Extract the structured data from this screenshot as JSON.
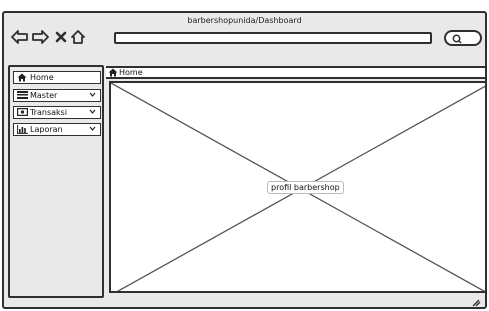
{
  "window": {
    "title": "barbershopunida/Dashboard"
  },
  "toolbar": {
    "icons": [
      "back-arrow-icon",
      "forward-arrow-icon",
      "close-x-icon",
      "home-icon"
    ],
    "url_value": "",
    "search_icon": "search-icon"
  },
  "sidebar": {
    "items": [
      {
        "label": "Home",
        "icon": "home-icon",
        "has_chevron": false
      },
      {
        "label": "Master",
        "icon": "list-icon",
        "has_chevron": true
      },
      {
        "label": "Transaksi",
        "icon": "money-icon",
        "has_chevron": true
      },
      {
        "label": "Laporan",
        "icon": "chart-icon",
        "has_chevron": true
      }
    ]
  },
  "main": {
    "breadcrumb": "Home",
    "image_label": "profil barbershop"
  },
  "colors": {
    "stroke": "#2f2f2f",
    "chrome": "#e9e9e9",
    "surface": "#ffffff"
  }
}
